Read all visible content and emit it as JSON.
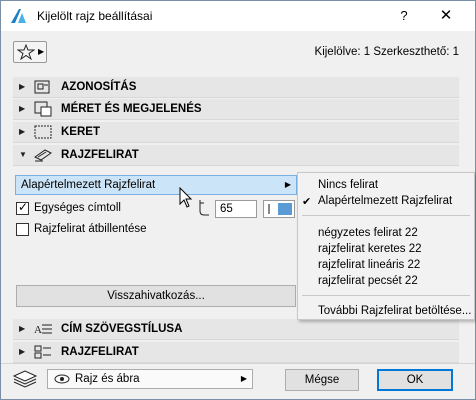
{
  "window": {
    "title": "Kijelölt rajz beállításai",
    "help": "?",
    "close": "✕"
  },
  "selection_info": "Kijelölve: 1 Szerkeszthető: 1",
  "sections": [
    {
      "label": "AZONOSÍTÁS",
      "icon": "id-icon",
      "expanded": false
    },
    {
      "label": "MÉRET ÉS MEGJELENÉS",
      "icon": "size-appearance-icon",
      "expanded": false
    },
    {
      "label": "KERET",
      "icon": "frame-icon",
      "expanded": false
    },
    {
      "label": "RAJZFELIRAT",
      "icon": "drawing-title-icon",
      "expanded": true
    }
  ],
  "title_panel": {
    "selected_title": "Alapértelmezett Rajzfelirat",
    "uniform_text": {
      "label": "Egységes címtoll",
      "checked": true
    },
    "pen_value": "65",
    "flip_title": {
      "label": "Rajzfelirat átbillentése",
      "checked": false
    },
    "references_button": "Visszahivatkozás..."
  },
  "title_menu": {
    "items_top": [
      "Nincs felirat",
      "Alapértelmezett Rajzfelirat"
    ],
    "checked_item": "Alapértelmezett Rajzfelirat",
    "items_mid": [
      "négyzetes felirat 22",
      "rajzfelirat keretes 22",
      "rajzfelirat lineáris 22",
      "rajzfelirat pecsét 22"
    ],
    "item_bottom": "További Rajzfelirat betöltése..."
  },
  "lower_sections": [
    {
      "label": "CÍM SZÖVEGSTÍLUSA",
      "icon": "text-style-icon"
    },
    {
      "label": "RAJZFELIRAT",
      "icon": "drawing-title-params-icon"
    }
  ],
  "footer": {
    "view_select": "Rajz és ábra",
    "cancel": "Mégse",
    "ok": "OK"
  },
  "colors": {
    "highlight": "#cce4f7",
    "accent": "#0078d7",
    "toggle": "#5b9bd5"
  }
}
